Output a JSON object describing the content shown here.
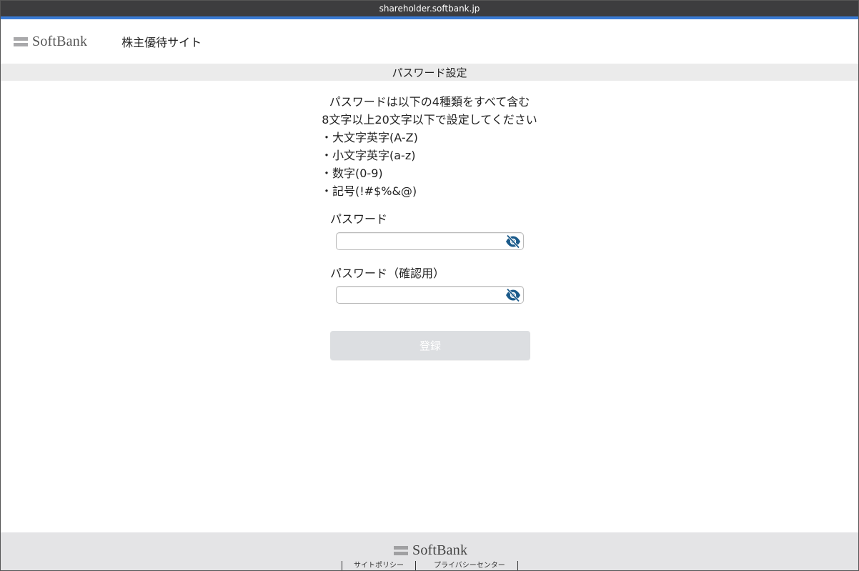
{
  "browser": {
    "url": "shareholder.softbank.jp"
  },
  "header": {
    "logo_text": "SoftBank",
    "site_name": "株主優待サイト"
  },
  "page_title": "パスワード設定",
  "rules": {
    "lead_1": "パスワードは以下の4種類をすべて含む",
    "lead_2": "8文字以上20文字以下で設定してください",
    "items": [
      "・大文字英字(A-Z)",
      "・小文字英字(a-z)",
      "・数字(0-9)",
      "・記号(!#$%&@)"
    ]
  },
  "form": {
    "password_label": "パスワード",
    "password_value": "",
    "confirm_label": "パスワード（確認用）",
    "confirm_value": "",
    "submit_label": "登録"
  },
  "footer": {
    "logo_text": "SoftBank",
    "links": [
      "サイトポリシー",
      "プライバシーセンター"
    ]
  },
  "colors": {
    "accent": "#1a5a8a",
    "disabled_button": "#dcdee1",
    "band": "#ebebeb",
    "footer_bg": "#e4e4e6"
  },
  "icons": {
    "toggle_visibility": "eye-slash-icon"
  }
}
